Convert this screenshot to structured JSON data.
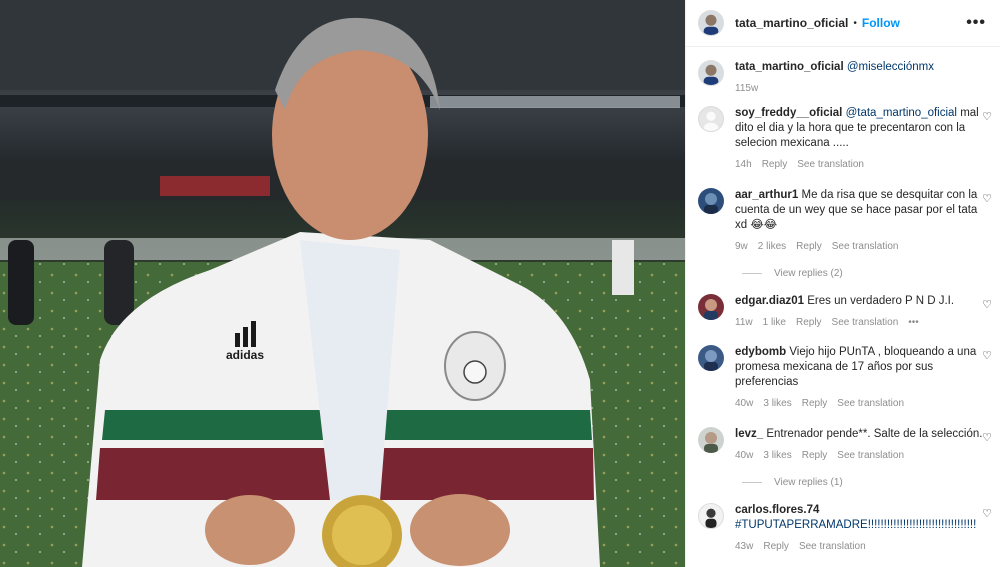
{
  "post": {
    "username": "tata_martino_oficial",
    "separator": "•",
    "follow_label": "Follow",
    "more_icon": "more-options-icon",
    "caption": {
      "username": "tata_martino_oficial",
      "text": "@miselecciónmx",
      "time": "115w"
    }
  },
  "photo": {
    "brand_text": "adidas"
  },
  "comments": [
    {
      "username": "soy_freddy__oficial",
      "mention": "@tata_martino_oficial",
      "text": "mal dito el dia y la hora que te precentaron con la selecion mexicana .....",
      "time": "14h",
      "likes": "",
      "reply": "Reply",
      "translate": "See translation",
      "more": ""
    },
    {
      "username": "aar_arthur1",
      "mention": "",
      "text": "Me da risa que se desquitar con la cuenta de un wey que se hace pasar por el tata xd 😂😂",
      "time": "9w",
      "likes": "2 likes",
      "reply": "Reply",
      "translate": "See translation",
      "more": "",
      "replies": "View replies (2)"
    },
    {
      "username": "edgar.diaz01",
      "mention": "",
      "text": "Eres un verdadero P N D J.I.",
      "time": "11w",
      "likes": "1 like",
      "reply": "Reply",
      "translate": "See translation",
      "more": "•••"
    },
    {
      "username": "edybomb",
      "mention": "",
      "text": "Viejo hijo PUnTA , bloqueando a una promesa mexicana de 17 años por sus preferencias",
      "time": "40w",
      "likes": "3 likes",
      "reply": "Reply",
      "translate": "See translation",
      "more": ""
    },
    {
      "username": "levz_",
      "mention": "",
      "text": "Entrenador pende**. Salte de la selección.",
      "time": "40w",
      "likes": "3 likes",
      "reply": "Reply",
      "translate": "See translation",
      "more": "",
      "replies": "View replies (1)"
    },
    {
      "username": "carlos.flores.74",
      "mention": "",
      "text": "#TUPUTAPERRAMADRE!!!!!!!!!!!!!!!!!!!!!!!!!!!!!!!!!!",
      "time": "43w",
      "likes": "",
      "reply": "Reply",
      "translate": "See translation",
      "more": ""
    }
  ],
  "colors": {
    "follow": "#0095f6",
    "mention": "#00376b",
    "meta": "#8e8e8e"
  }
}
